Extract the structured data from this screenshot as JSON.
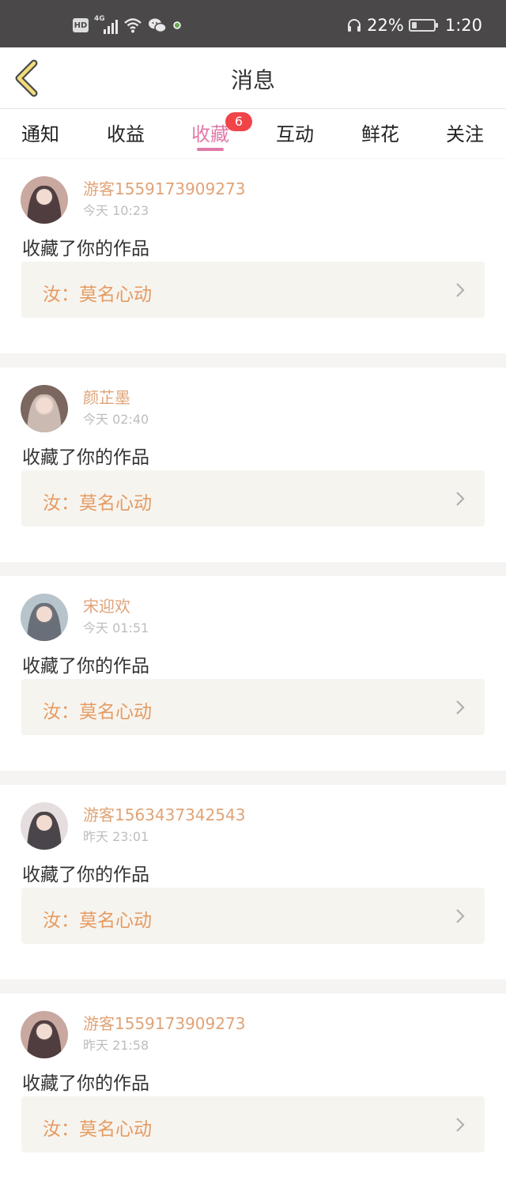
{
  "status_bar": {
    "hd": "HD",
    "network": "4G",
    "battery_percent": "22%",
    "battery_level": 0.22,
    "time": "1:20"
  },
  "header": {
    "title": "消息"
  },
  "tabs": [
    {
      "label": "通知",
      "active": false
    },
    {
      "label": "收益",
      "active": false
    },
    {
      "label": "收藏",
      "active": true,
      "badge": "6"
    },
    {
      "label": "互动",
      "active": false
    },
    {
      "label": "鲜花",
      "active": false
    },
    {
      "label": "关注",
      "active": false
    }
  ],
  "messages": [
    {
      "username": "游客1559173909273",
      "time": "今天 10:23",
      "action": "收藏了你的作品",
      "work_title": "汝：莫名心动",
      "avatar_colors": [
        "#c9a8a0",
        "#3a2a2e"
      ]
    },
    {
      "username": "颜芷墨",
      "time": "今天 02:40",
      "action": "收藏了你的作品",
      "work_title": "汝：莫名心动",
      "avatar_colors": [
        "#7b6660",
        "#d9c9c0"
      ]
    },
    {
      "username": "宋迎欢",
      "time": "今天 01:51",
      "action": "收藏了你的作品",
      "work_title": "汝：莫名心动",
      "avatar_colors": [
        "#b8c4cc",
        "#5a6068"
      ]
    },
    {
      "username": "游客1563437342543",
      "time": "昨天 23:01",
      "action": "收藏了你的作品",
      "work_title": "汝：莫名心动",
      "avatar_colors": [
        "#e6dede",
        "#2e2a30"
      ]
    },
    {
      "username": "游客1559173909273",
      "time": "昨天 21:58",
      "action": "收藏了你的作品",
      "work_title": "汝：莫名心动",
      "avatar_colors": [
        "#c9a8a0",
        "#3a2a2e"
      ]
    }
  ],
  "colors": {
    "accent_pink": "#e07aa8",
    "username_orange": "#e0a377",
    "work_title_orange": "#e59b62",
    "badge_red": "#f04448"
  }
}
